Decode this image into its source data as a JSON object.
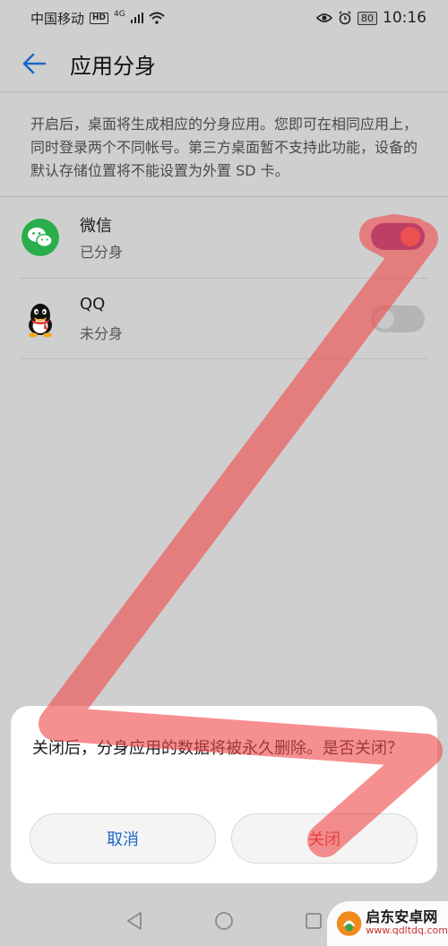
{
  "status_bar": {
    "carrier": "中国移动",
    "hd_badge": "HD",
    "network": "4G",
    "battery": "80",
    "time": "10:16"
  },
  "header": {
    "title": "应用分身",
    "back_icon": "back-arrow-icon"
  },
  "description": "开启后，桌面将生成相应的分身应用。您即可在相同应用上，同时登录两个不同帐号。第三方桌面暂不支持此功能，设备的默认存储位置将不能设置为外置 SD 卡。",
  "apps": [
    {
      "name": "微信",
      "status": "已分身",
      "icon": "wechat-icon",
      "enabled": true
    },
    {
      "name": "QQ",
      "status": "未分身",
      "icon": "qq-icon",
      "enabled": false
    }
  ],
  "dialog": {
    "message": "关闭后，分身应用的数据将被永久删除。是否关闭？",
    "cancel_label": "取消",
    "confirm_label": "关闭"
  },
  "nav": {
    "back_icon": "nav-back-icon",
    "home_icon": "nav-home-icon",
    "recents_icon": "nav-recents-icon"
  },
  "watermark": {
    "title": "启东安卓网",
    "url": "www.qdltdq.com"
  },
  "colors": {
    "accent": "#1a68c9",
    "toggle_on": "#6b2f8f",
    "danger": "#d0342c",
    "annotation": "#f04a4a"
  }
}
